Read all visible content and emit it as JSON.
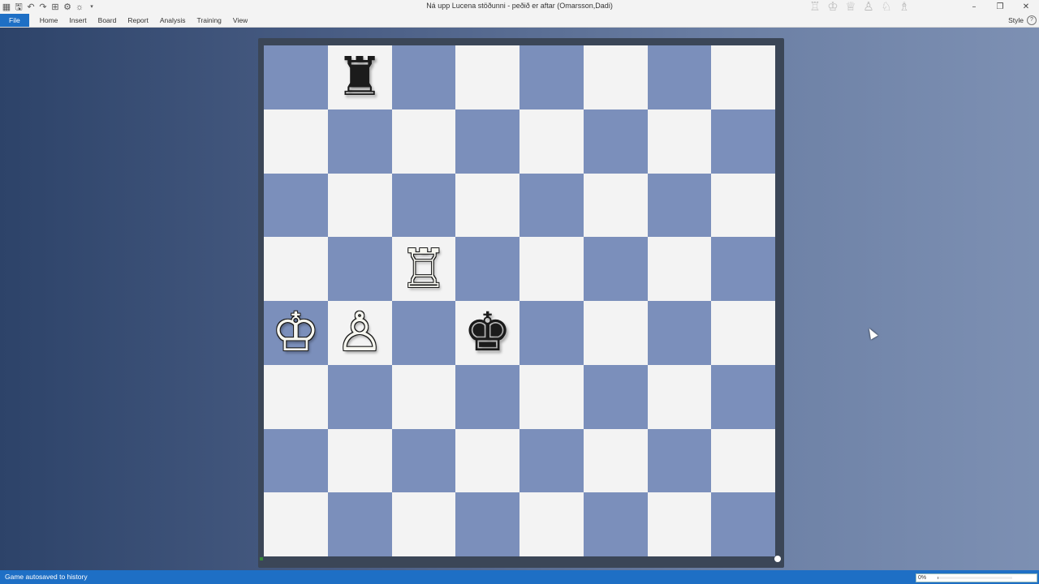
{
  "window": {
    "title": "Ná upp Lucena stöðunni - peðið er aftar  (Omarsson,Dadi)",
    "quick_access_icons": [
      "app-icon",
      "save-icon",
      "undo-icon",
      "redo-icon",
      "grid-icon",
      "settings-icon",
      "brightness-icon",
      "dropdown-icon"
    ],
    "piece_palette_icons": [
      "♖",
      "♔",
      "♕",
      "♙",
      "♘",
      "♗"
    ],
    "controls": {
      "minimize": "–",
      "restore": "❐",
      "close": "✕"
    }
  },
  "ribbon": {
    "tabs": [
      "File",
      "Home",
      "Insert",
      "Board",
      "Report",
      "Analysis",
      "Training",
      "View"
    ],
    "style_label": "Style",
    "help_label": "?"
  },
  "board": {
    "light_color": "#f3f3f3",
    "dark_color": "#7b8fbb",
    "position": {
      "b8": {
        "glyph": "♜",
        "color": "black",
        "name": "black-rook"
      },
      "c5": {
        "glyph": "♖",
        "color": "white",
        "name": "white-rook"
      },
      "a4": {
        "glyph": "♔",
        "color": "white",
        "name": "white-king"
      },
      "b4": {
        "glyph": "♙",
        "color": "white",
        "name": "white-pawn"
      },
      "d4": {
        "glyph": "♚",
        "color": "black",
        "name": "black-king"
      }
    }
  },
  "status": {
    "text": "Game autosaved to history",
    "progress_label": "0%",
    "progress": 0
  }
}
